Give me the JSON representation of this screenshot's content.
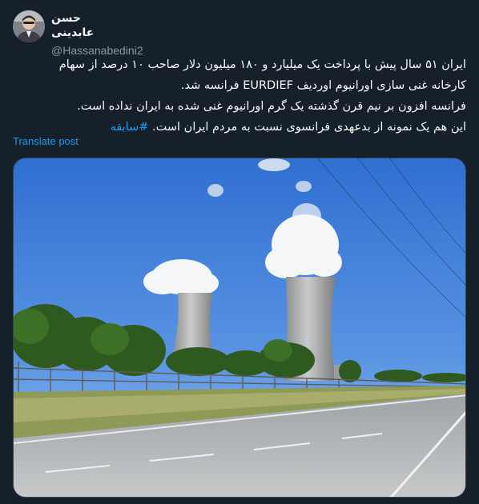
{
  "author": {
    "display_name": "حسن عابدینی",
    "handle": "@Hassanabedini2",
    "avatar_icon": "profile-photo"
  },
  "tweet": {
    "lines": [
      "ایران ۵۱ سال پیش با پرداخت یک میلیارد و ۱۸۰ میلیون دلار صاحب ۱۰ درصد از سهام",
      "کارخانه غنی سازی اورانیوم اوردیف EURDIEF فرانسه شد.",
      "فرانسه افزون بر نیم قرن گذشته یک گرم اورانیوم غنی شده به ایران نداده است.",
      "این هم یک نمونه از بدعهدی فرانسوی نسبت به مردم ایران است."
    ],
    "hashtag": "#سابقه"
  },
  "translate_label": "Translate post",
  "media": {
    "description_icon": "nuclear-plant-photo"
  },
  "colors": {
    "background": "#15202b",
    "text": "#f7f9f9",
    "secondary": "#8b98a5",
    "link": "#1d9bf0"
  }
}
